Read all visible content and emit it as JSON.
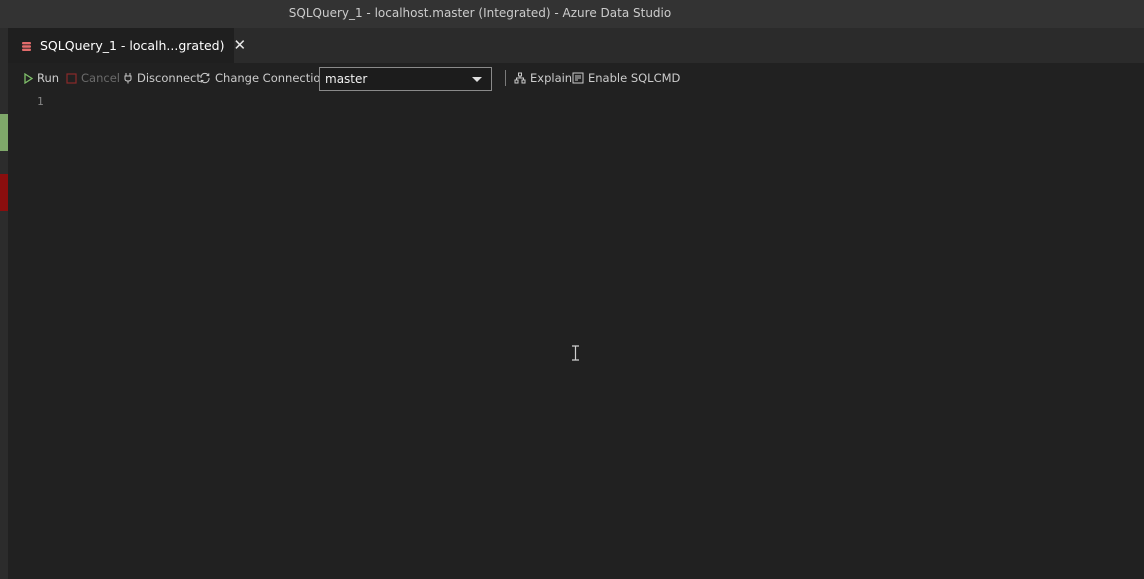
{
  "window": {
    "title": "SQLQuery_1 - localhost.master (Integrated) - Azure Data Studio"
  },
  "tab": {
    "label": "SQLQuery_1 - localh...grated)",
    "icon": "database-icon",
    "close_glyph": "✕"
  },
  "toolbar": {
    "run_label": "Run",
    "cancel_label": "Cancel",
    "disconnect_label": "Disconnect",
    "change_connection_label": "Change Connection",
    "database_select_value": "master",
    "explain_label": "Explain",
    "enable_sqlcmd_label": "Enable SQLCMD"
  },
  "editor": {
    "line_numbers": [
      "1"
    ]
  },
  "colors": {
    "accent_green": "#7fa86a",
    "error_red": "#8a0e0e",
    "tab_icon": "#e26b6b"
  }
}
